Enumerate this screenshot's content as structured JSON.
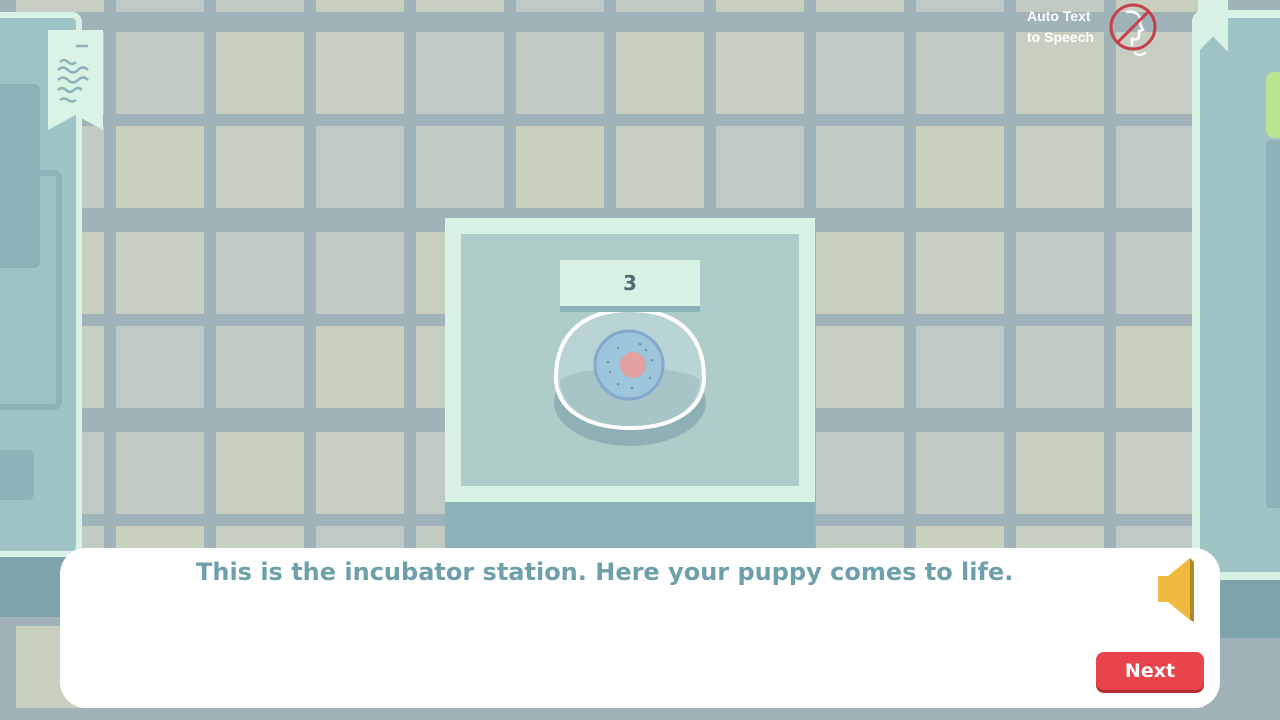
{
  "scene": "incubator-station",
  "tts": {
    "label_line1": "Auto Text",
    "label_line2": "to Speech",
    "enabled": false,
    "icon": "speech-off-icon"
  },
  "incubator": {
    "count": "3"
  },
  "dialogue": {
    "text": "This is the incubator station. Here your puppy comes to life.",
    "speaker_icon": "speaker-icon",
    "next_label": "Next"
  },
  "colors": {
    "accent_button": "#e9434b",
    "dialogue_text": "#6ea0ab",
    "speaker": "#f0b93f",
    "station_frame": "#d8f2e6",
    "station_inner": "#aecdc8"
  }
}
